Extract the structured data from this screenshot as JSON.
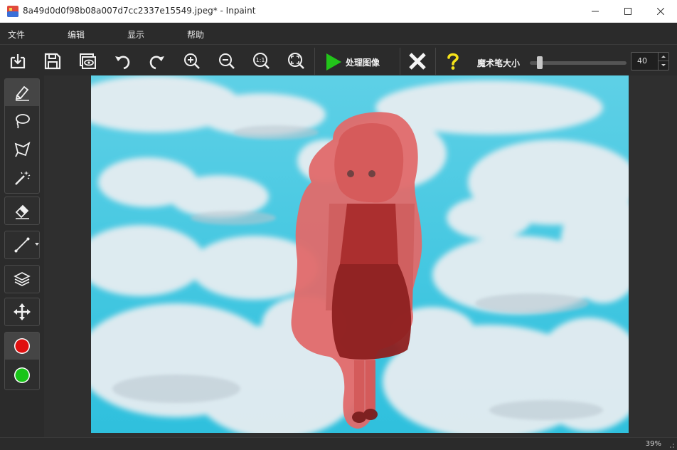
{
  "window": {
    "title": "8a49d0d0f98b08a007d7cc2337e15549.jpeg* - Inpaint",
    "controls": [
      "minimize",
      "maximize",
      "close"
    ]
  },
  "menu": {
    "file": "文件",
    "edit": "编辑",
    "view": "显示",
    "help": "帮助"
  },
  "toolbar": {
    "buttons": [
      {
        "name": "open-icon",
        "tooltip": ""
      },
      {
        "name": "save-icon",
        "tooltip": ""
      },
      {
        "name": "preview-icon",
        "tooltip": ""
      },
      {
        "name": "undo-icon",
        "tooltip": ""
      },
      {
        "name": "redo-icon",
        "tooltip": ""
      },
      {
        "name": "zoom-in-icon",
        "tooltip": ""
      },
      {
        "name": "zoom-out-icon",
        "tooltip": ""
      },
      {
        "name": "actual-size-icon",
        "tooltip": "",
        "text": "1:1"
      },
      {
        "name": "fit-window-icon",
        "tooltip": ""
      }
    ],
    "process_label": "处理图像",
    "cancel_icon": "close-x-icon",
    "help_icon": "question-mark-icon",
    "brush_size_label": "魔术笔大小",
    "brush_size_value": "40",
    "brush_size_fraction": 0.08
  },
  "tools": [
    {
      "name": "marker-icon",
      "active": true
    },
    {
      "name": "lasso-icon",
      "active": false
    },
    {
      "name": "polygon-lasso-icon",
      "active": false
    },
    {
      "name": "magic-wand-icon",
      "active": false
    },
    {
      "name": "eraser-icon",
      "active": false
    },
    {
      "name": "line-icon",
      "active": false
    },
    {
      "name": "layers-icon",
      "active": false
    },
    {
      "name": "move-icon",
      "active": false
    },
    {
      "name": "red-color-swatch",
      "color": "#e01010"
    },
    {
      "name": "green-color-swatch",
      "color": "#18c418"
    }
  ],
  "colors": {
    "accent_green": "#22c41a",
    "help_yellow": "#f5e21a",
    "mask_red": "#e83a3a",
    "sky_blue": "#45c7e0"
  },
  "status": {
    "zoom": "39%"
  }
}
